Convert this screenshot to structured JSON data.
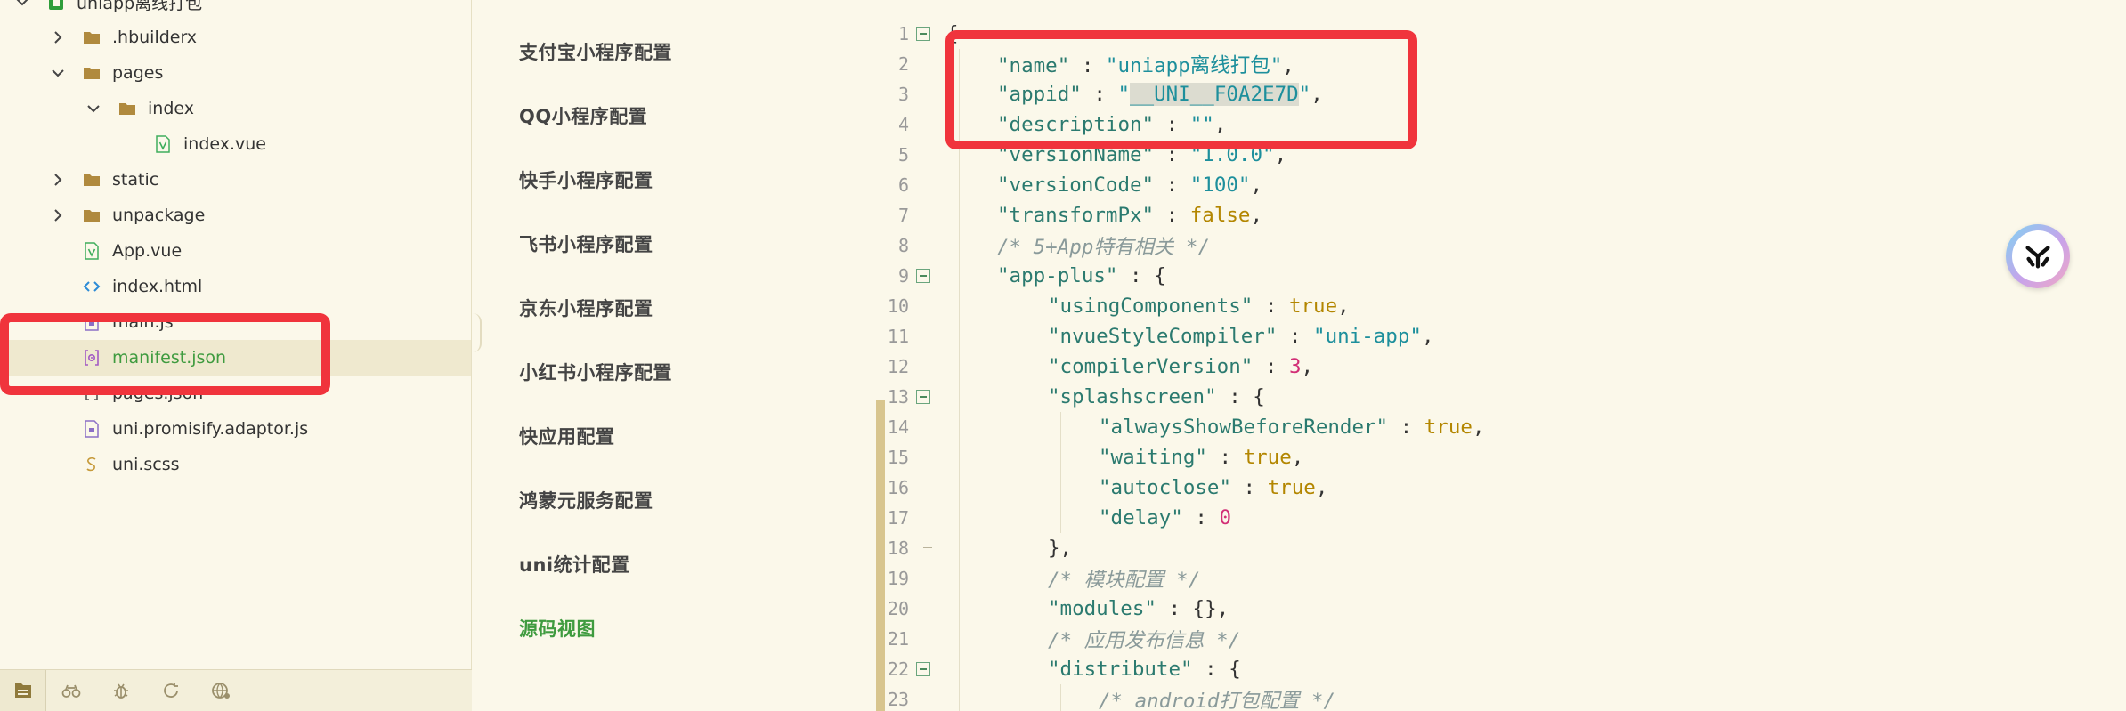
{
  "tree": {
    "items": [
      {
        "label": "uniapp离线打包",
        "type": "project",
        "expanded": true
      },
      {
        "label": ".hbuilderx",
        "type": "folder",
        "expanded": false
      },
      {
        "label": "pages",
        "type": "folder",
        "expanded": true
      },
      {
        "label": "index",
        "type": "folder",
        "expanded": true
      },
      {
        "label": "index.vue",
        "type": "vue"
      },
      {
        "label": "static",
        "type": "folder",
        "expanded": false
      },
      {
        "label": "unpackage",
        "type": "folder",
        "expanded": false
      },
      {
        "label": "App.vue",
        "type": "vue"
      },
      {
        "label": "index.html",
        "type": "html"
      },
      {
        "label": "main.js",
        "type": "js"
      },
      {
        "label": "manifest.json",
        "type": "json-settings",
        "selected": true
      },
      {
        "label": "pages.json",
        "type": "json"
      },
      {
        "label": "uni.promisify.adaptor.js",
        "type": "js"
      },
      {
        "label": "uni.scss",
        "type": "scss"
      }
    ]
  },
  "bottom_tools": [
    "files-icon",
    "binoculars-icon",
    "bug-icon",
    "refresh-icon",
    "globe-icon"
  ],
  "config_nav": {
    "items": [
      {
        "label": "支付宝小程序配置"
      },
      {
        "label": "QQ小程序配置"
      },
      {
        "label": "快手小程序配置"
      },
      {
        "label": "飞书小程序配置"
      },
      {
        "label": "京东小程序配置"
      },
      {
        "label": "小红书小程序配置"
      },
      {
        "label": "快应用配置"
      },
      {
        "label": "鸿蒙元服务配置"
      },
      {
        "label": "uni统计配置"
      },
      {
        "label": "源码视图",
        "active": true
      }
    ]
  },
  "editor": {
    "lines": [
      {
        "n": "1",
        "fold": "box",
        "indent": 0,
        "tokens": [
          [
            "p",
            "{"
          ]
        ]
      },
      {
        "n": "2",
        "indent": 1,
        "tokens": [
          [
            "k",
            "\"name\""
          ],
          [
            "p",
            " : "
          ],
          [
            "s",
            "\"uniapp离线打包\""
          ],
          [
            "p",
            ","
          ]
        ]
      },
      {
        "n": "3",
        "indent": 1,
        "tokens": [
          [
            "k",
            "\"appid\""
          ],
          [
            "p",
            " : "
          ],
          [
            "s",
            "\""
          ],
          [
            "h",
            "__UNI__F0A2E7D"
          ],
          [
            "s",
            "\""
          ],
          [
            "p",
            ","
          ]
        ]
      },
      {
        "n": "4",
        "indent": 1,
        "tokens": [
          [
            "k",
            "\"description\""
          ],
          [
            "p",
            " : "
          ],
          [
            "s",
            "\"\""
          ],
          [
            "p",
            ","
          ]
        ]
      },
      {
        "n": "5",
        "indent": 1,
        "tokens": [
          [
            "k",
            "\"versionName\""
          ],
          [
            "p",
            " : "
          ],
          [
            "s",
            "\"1.0.0\""
          ],
          [
            "p",
            ","
          ]
        ]
      },
      {
        "n": "6",
        "indent": 1,
        "tokens": [
          [
            "k",
            "\"versionCode\""
          ],
          [
            "p",
            " : "
          ],
          [
            "s",
            "\"100\""
          ],
          [
            "p",
            ","
          ]
        ]
      },
      {
        "n": "7",
        "indent": 1,
        "tokens": [
          [
            "k",
            "\"transformPx\""
          ],
          [
            "p",
            " : "
          ],
          [
            "b",
            "false"
          ],
          [
            "p",
            ","
          ]
        ]
      },
      {
        "n": "8",
        "indent": 1,
        "tokens": [
          [
            "c",
            "/* 5+App特有相关 */"
          ]
        ]
      },
      {
        "n": "9",
        "fold": "box",
        "indent": 1,
        "tokens": [
          [
            "k",
            "\"app-plus\""
          ],
          [
            "p",
            " : {"
          ]
        ]
      },
      {
        "n": "10",
        "indent": 2,
        "tokens": [
          [
            "k",
            "\"usingComponents\""
          ],
          [
            "p",
            " : "
          ],
          [
            "b",
            "true"
          ],
          [
            "p",
            ","
          ]
        ]
      },
      {
        "n": "11",
        "indent": 2,
        "tokens": [
          [
            "k",
            "\"nvueStyleCompiler\""
          ],
          [
            "p",
            " : "
          ],
          [
            "s",
            "\"uni-app\""
          ],
          [
            "p",
            ","
          ]
        ]
      },
      {
        "n": "12",
        "indent": 2,
        "tokens": [
          [
            "k",
            "\"compilerVersion\""
          ],
          [
            "p",
            " : "
          ],
          [
            "n",
            "3"
          ],
          [
            "p",
            ","
          ]
        ]
      },
      {
        "n": "13",
        "fold": "box",
        "indent": 2,
        "tokens": [
          [
            "k",
            "\"splashscreen\""
          ],
          [
            "p",
            " : {"
          ]
        ]
      },
      {
        "n": "14",
        "indent": 3,
        "tokens": [
          [
            "k",
            "\"alwaysShowBeforeRender\""
          ],
          [
            "p",
            " : "
          ],
          [
            "b",
            "true"
          ],
          [
            "p",
            ","
          ]
        ]
      },
      {
        "n": "15",
        "indent": 3,
        "tokens": [
          [
            "k",
            "\"waiting\""
          ],
          [
            "p",
            " : "
          ],
          [
            "b",
            "true"
          ],
          [
            "p",
            ","
          ]
        ]
      },
      {
        "n": "16",
        "indent": 3,
        "tokens": [
          [
            "k",
            "\"autoclose\""
          ],
          [
            "p",
            " : "
          ],
          [
            "b",
            "true"
          ],
          [
            "p",
            ","
          ]
        ]
      },
      {
        "n": "17",
        "indent": 3,
        "tokens": [
          [
            "k",
            "\"delay\""
          ],
          [
            "p",
            " : "
          ],
          [
            "n",
            "0"
          ]
        ]
      },
      {
        "n": "18",
        "fold": "end",
        "indent": 2,
        "tokens": [
          [
            "p",
            "},"
          ]
        ]
      },
      {
        "n": "19",
        "indent": 2,
        "tokens": [
          [
            "c",
            "/* 模块配置 */"
          ]
        ]
      },
      {
        "n": "20",
        "indent": 2,
        "tokens": [
          [
            "k",
            "\"modules\""
          ],
          [
            "p",
            " : {},"
          ]
        ]
      },
      {
        "n": "21",
        "indent": 2,
        "tokens": [
          [
            "c",
            "/* 应用发布信息 */"
          ]
        ]
      },
      {
        "n": "22",
        "fold": "box",
        "indent": 2,
        "tokens": [
          [
            "k",
            "\"distribute\""
          ],
          [
            "p",
            " : {"
          ]
        ]
      },
      {
        "n": "23",
        "indent": 3,
        "tokens": [
          [
            "c",
            "/* android打包配置 */"
          ]
        ]
      }
    ]
  },
  "colors": {
    "background": "#fbf8ea",
    "accent_green": "#3f9b3f",
    "annotation_red": "#f0343c"
  }
}
